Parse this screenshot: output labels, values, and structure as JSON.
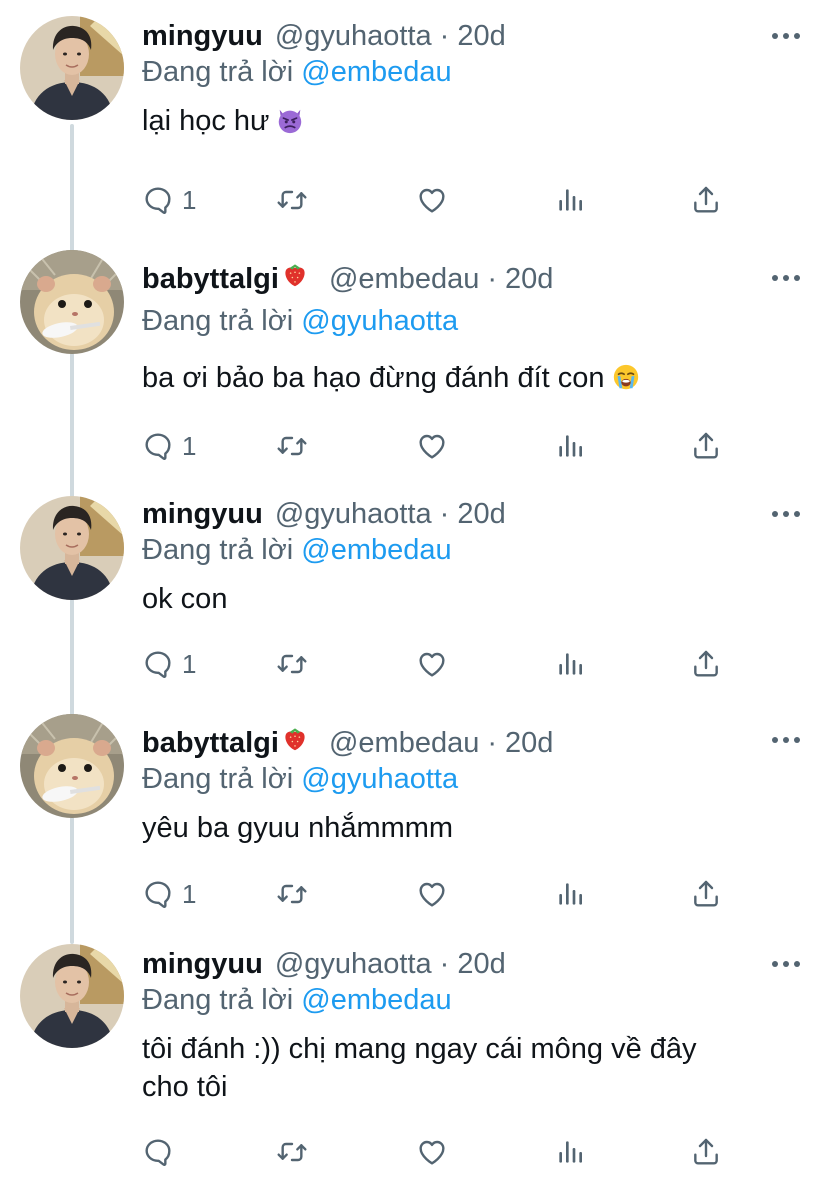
{
  "reply_prefix": "Đang trả lời",
  "dot": "·",
  "colors": {
    "accent": "#1d9bf0",
    "muted": "#536471",
    "text": "#0f1419",
    "thread_line": "#cfd9de"
  },
  "tweets": [
    {
      "name": "mingyuu",
      "name_emoji": "",
      "handle": "@gyuhaotta",
      "time": "20d",
      "reply_to": "@embedau",
      "text": "lại học hư",
      "text_emoji": "smiling-imp-emoji",
      "reply_count": "1",
      "avatar": "person-avatar"
    },
    {
      "name": "babyttalgi",
      "name_emoji": "strawberry-emoji",
      "handle": "@embedau",
      "time": "20d",
      "reply_to": "@gyuhaotta",
      "text": "ba ơi bảo ba hạo đừng đánh đít con",
      "text_emoji": "loudly-crying-face-emoji",
      "reply_count": "1",
      "avatar": "hamster-avatar"
    },
    {
      "name": "mingyuu",
      "name_emoji": "",
      "handle": "@gyuhaotta",
      "time": "20d",
      "reply_to": "@embedau",
      "text": "ok con",
      "text_emoji": "",
      "reply_count": "1",
      "avatar": "person-avatar"
    },
    {
      "name": "babyttalgi",
      "name_emoji": "strawberry-emoji",
      "handle": "@embedau",
      "time": "20d",
      "reply_to": "@gyuhaotta",
      "text": "yêu ba gyuu nhắmmmm",
      "text_emoji": "",
      "reply_count": "1",
      "avatar": "hamster-avatar"
    },
    {
      "name": "mingyuu",
      "name_emoji": "",
      "handle": "@gyuhaotta",
      "time": "20d",
      "reply_to": "@embedau",
      "text_line1": "tôi đánh :)) chị mang ngay cái mông về đây",
      "text_line2": "cho tôi",
      "text_emoji": "",
      "reply_count": "",
      "avatar": "person-avatar"
    }
  ]
}
